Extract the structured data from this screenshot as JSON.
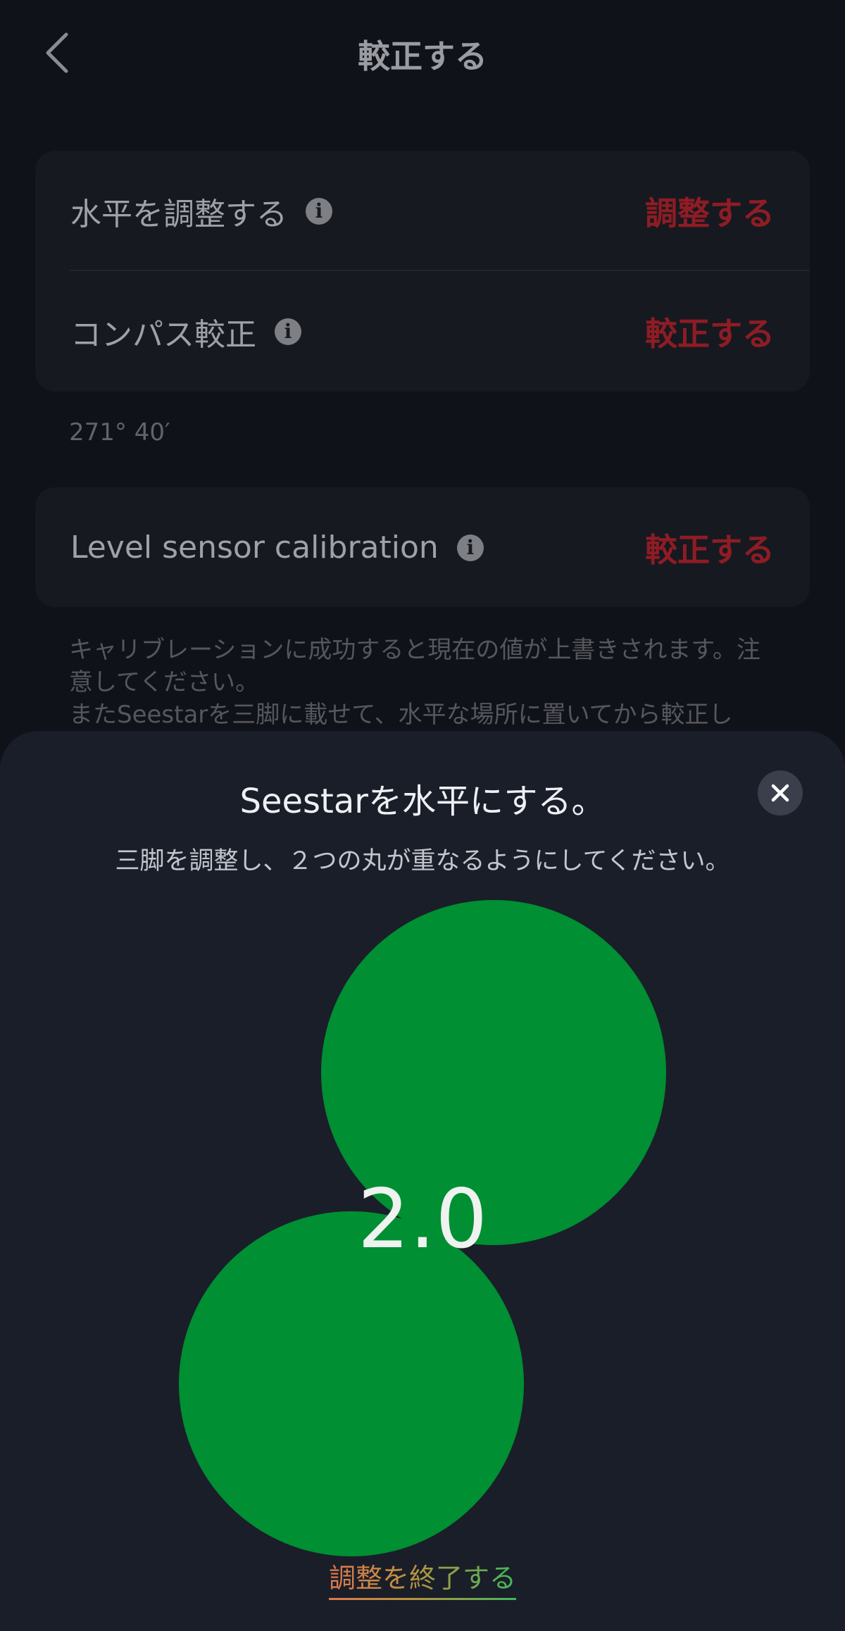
{
  "header": {
    "title": "較正する"
  },
  "settings": {
    "rows": [
      {
        "label": "水平を調整する",
        "action": "調整する"
      },
      {
        "label": "コンパス較正",
        "action": "較正する"
      }
    ],
    "compass_reading": "271° 40′",
    "sensor_row": {
      "label": "Level sensor calibration",
      "action": "較正する"
    },
    "notice": "キャリブレーションに成功すると現在の値が上書きされます。注意してください。\nまたSeestarを三脚に載せて、水平な場所に置いてから較正し"
  },
  "sheet": {
    "title": "Seestarを水平にする。",
    "subtitle": "三脚を調整し、２つの丸が重なるようにしてください。",
    "level_value": "2.0",
    "finish_label": "調整を終了する"
  },
  "colors": {
    "accent_action": "#8f1c24",
    "bubble": "#008f32",
    "sheet_bg": "#1a1e29"
  },
  "icons": [
    "chevron-left-icon",
    "info-icon",
    "close-icon"
  ]
}
